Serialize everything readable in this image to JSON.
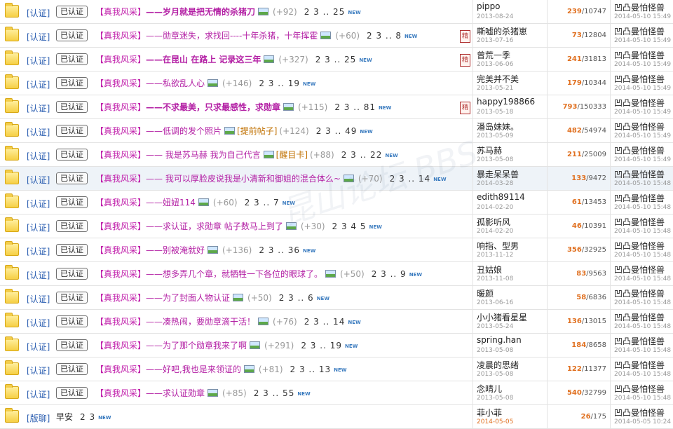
{
  "threads": [
    {
      "prefix": "[认证]",
      "badge": "已认证",
      "tag": "【真我风采】",
      "title": "——岁月就是把无情的杀猪刀",
      "bold": true,
      "extra": "",
      "score": "(+92)",
      "pages": "2 3 .. 25",
      "new": "NEW",
      "rstamp": "",
      "author": "pippo",
      "date": "2013-08-24",
      "replies": "239",
      "views": "/10747",
      "last_author": "凹凸曼怕怪兽",
      "last_time": "2014-05-10 15:49"
    },
    {
      "prefix": "[认证]",
      "badge": "已认证",
      "tag": "【真我风采】",
      "title": "——勋章迷失，求找回----十年杀猪，十年挥霍",
      "bold": false,
      "extra": "",
      "score": "(+60)",
      "pages": "2 3 .. 8",
      "new": "NEW",
      "rstamp": "精",
      "author": "嘶嘘的杀猪崽",
      "date": "2013-07-16",
      "replies": "73",
      "views": "/12804",
      "last_author": "凹凸曼怕怪兽",
      "last_time": "2014-05-10 15:49"
    },
    {
      "prefix": "[认证]",
      "badge": "已认证",
      "tag": "【真我风采】",
      "title": "——在昆山 在路上 记录这三年",
      "bold": true,
      "extra": "",
      "score": "(+327)",
      "pages": "2 3 .. 25",
      "new": "NEW",
      "rstamp": "精",
      "author": "曾荒一季",
      "date": "2013-06-06",
      "replies": "241",
      "views": "/31813",
      "last_author": "凹凸曼怕怪兽",
      "last_time": "2014-05-10 15:49"
    },
    {
      "prefix": "[认证]",
      "badge": "已认证",
      "tag": "【真我风采】",
      "title": "——私欲乱人心",
      "bold": false,
      "extra": "",
      "score": "(+146)",
      "pages": "2 3 .. 19",
      "new": "NEW",
      "rstamp": "",
      "author": "完美并不美",
      "date": "2013-05-21",
      "replies": "179",
      "views": "/10344",
      "last_author": "凹凸曼怕怪兽",
      "last_time": "2014-05-10 15:49"
    },
    {
      "prefix": "[认证]",
      "badge": "已认证",
      "tag": "【真我风采】",
      "title": "——不求最美，只求最感性，求勋章",
      "bold": true,
      "extra": "",
      "score": "(+115)",
      "pages": "2 3 .. 81",
      "new": "NEW",
      "rstamp": "精",
      "author": "happy198866",
      "date": "2013-05-18",
      "replies": "793",
      "views": "/150333",
      "last_author": "凹凸曼怕怪兽",
      "last_time": "2014-05-10 15:49"
    },
    {
      "prefix": "[认证]",
      "badge": "已认证",
      "tag": "【真我风采】",
      "title": "——低调的发个照片",
      "bold": false,
      "extra": "[提前帖子]",
      "score": "(+124)",
      "pages": "2 3 .. 49",
      "new": "NEW",
      "rstamp": "",
      "author": "潘岛妹妹。",
      "date": "2013-05-09",
      "replies": "482",
      "views": "/54974",
      "last_author": "凹凸曼怕怪兽",
      "last_time": "2014-05-10 15:49"
    },
    {
      "prefix": "[认证]",
      "badge": "已认证",
      "tag": "【真我风采】",
      "title": "—— 我是苏马赫 我为自己代言",
      "bold": false,
      "extra": "[醒目卡]",
      "score": "(+88)",
      "pages": "2 3 .. 22",
      "new": "NEW",
      "rstamp": "",
      "author": "苏马赫",
      "date": "2013-05-08",
      "replies": "211",
      "views": "/25009",
      "last_author": "凹凸曼怕怪兽",
      "last_time": "2014-05-10 15:49"
    },
    {
      "prefix": "[认证]",
      "badge": "已认证",
      "tag": "【真我风采】",
      "title": "—— 我可以厚脸皮说我是小清新和御姐的混合体么~",
      "bold": false,
      "extra": "",
      "score": "(+70)",
      "pages": "2 3 .. 14",
      "new": "NEW",
      "rstamp": "",
      "author": "暴走呆呆兽",
      "date": "2014-03-28",
      "replies": "133",
      "views": "/9472",
      "last_author": "凹凸曼怕怪兽",
      "last_time": "2014-05-10 15:48"
    },
    {
      "prefix": "[认证]",
      "badge": "已认证",
      "tag": "【真我风采】",
      "title": "——妞妞114",
      "bold": false,
      "extra": "",
      "score": "(+60)",
      "pages": "2 3 .. 7",
      "new": "NEW",
      "rstamp": "",
      "author": "edith89114",
      "date": "2014-02-20",
      "replies": "61",
      "views": "/13453",
      "last_author": "凹凸曼怕怪兽",
      "last_time": "2014-05-10 15:48"
    },
    {
      "prefix": "[认证]",
      "badge": "已认证",
      "tag": "【真我风采】",
      "title": "——求认证，求勋章 帖子数马上到了",
      "bold": false,
      "extra": "",
      "score": "(+30)",
      "pages": "2 3 4 5",
      "new": "NEW",
      "rstamp": "",
      "author": "孤影听风",
      "date": "2014-02-20",
      "replies": "46",
      "views": "/10391",
      "last_author": "凹凸曼怕怪兽",
      "last_time": "2014-05-10 15:48"
    },
    {
      "prefix": "[认证]",
      "badge": "已认证",
      "tag": "【真我风采】",
      "title": "——别被淹就好",
      "bold": false,
      "extra": "",
      "score": "(+136)",
      "pages": "2 3 .. 36",
      "new": "NEW",
      "rstamp": "",
      "author": "响指、型男",
      "date": "2013-11-12",
      "replies": "356",
      "views": "/32925",
      "last_author": "凹凸曼怕怪兽",
      "last_time": "2014-05-10 15:48"
    },
    {
      "prefix": "[认证]",
      "badge": "已认证",
      "tag": "【真我风采】",
      "title": "——想多弄几个章，就牺牲一下各位的眼球了。",
      "bold": false,
      "extra": "",
      "score": "(+50)",
      "pages": "2 3 .. 9",
      "new": "NEW",
      "rstamp": "",
      "author": "丑姑娘",
      "date": "2013-11-08",
      "replies": "83",
      "views": "/9563",
      "last_author": "凹凸曼怕怪兽",
      "last_time": "2014-05-10 15:48"
    },
    {
      "prefix": "[认证]",
      "badge": "已认证",
      "tag": "【真我风采】",
      "title": "——为了封面人物认证",
      "bold": false,
      "extra": "",
      "score": "(+50)",
      "pages": "2 3 .. 6",
      "new": "NEW",
      "rstamp": "",
      "author": "暖颜",
      "date": "2013-06-16",
      "replies": "58",
      "views": "/6836",
      "last_author": "凹凸曼怕怪兽",
      "last_time": "2014-05-10 15:48"
    },
    {
      "prefix": "[认证]",
      "badge": "已认证",
      "tag": "【真我风采】",
      "title": "——凑热闹，要勋章滴干活！",
      "bold": false,
      "extra": "",
      "score": "(+76)",
      "pages": "2 3 .. 14",
      "new": "NEW",
      "rstamp": "",
      "author": "小小猪看星星",
      "date": "2013-05-24",
      "replies": "136",
      "views": "/13015",
      "last_author": "凹凸曼怕怪兽",
      "last_time": "2014-05-10 15:48"
    },
    {
      "prefix": "[认证]",
      "badge": "已认证",
      "tag": "【真我风采】",
      "title": "——为了那个勋章我来了啊",
      "bold": false,
      "extra": "",
      "score": "(+291)",
      "pages": "2 3 .. 19",
      "new": "NEW",
      "rstamp": "",
      "author": "spring.han",
      "date": "2013-05-08",
      "replies": "184",
      "views": "/8658",
      "last_author": "凹凸曼怕怪兽",
      "last_time": "2014-05-10 15:48"
    },
    {
      "prefix": "[认证]",
      "badge": "已认证",
      "tag": "【真我风采】",
      "title": "——好吧,我也是来领证的",
      "bold": false,
      "extra": "",
      "score": "(+81)",
      "pages": "2 3 .. 13",
      "new": "NEW",
      "rstamp": "",
      "author": "凌晨的思绪",
      "date": "2013-05-08",
      "replies": "122",
      "views": "/11377",
      "last_author": "凹凸曼怕怪兽",
      "last_time": "2014-05-10 15:48"
    },
    {
      "prefix": "[认证]",
      "badge": "已认证",
      "tag": "【真我风采】",
      "title": "——求认证勋章",
      "bold": false,
      "extra": "",
      "score": "(+85)",
      "pages": "2 3 .. 55",
      "new": "NEW",
      "rstamp": "",
      "author": "念晴儿",
      "date": "2013-05-08",
      "replies": "540",
      "views": "/32799",
      "last_author": "凹凸曼怕怪兽",
      "last_time": "2014-05-10 15:48"
    },
    {
      "prefix": "[版聊]",
      "badge": "",
      "tag": "",
      "title": "早安",
      "bold": false,
      "extra": "",
      "score": "",
      "pages": "2 3",
      "new": "NEW",
      "rstamp": "",
      "author": "菲小菲",
      "date": "2014-05-05",
      "replies": "26",
      "views": "/175",
      "last_author": "凹凸曼怕怪兽",
      "last_time": "2014-05-05 10:24",
      "plain": true,
      "recent": true
    }
  ],
  "watermark": "昆山论坛 BBS",
  "colors": {
    "accent": "#b31fa4",
    "link": "#2a5db0",
    "replies": "#e07020"
  }
}
